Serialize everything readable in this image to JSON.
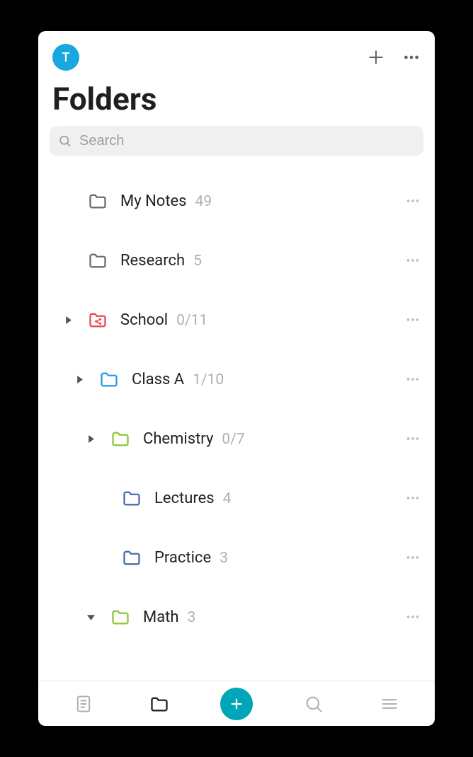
{
  "header": {
    "avatar_letter": "T"
  },
  "page_title": "Folders",
  "search": {
    "placeholder": "Search",
    "value": ""
  },
  "folders": [
    {
      "name": "My Notes",
      "count": "49",
      "indent": 0,
      "chevron": null,
      "icon_color": "#6b6d72",
      "icon_type": "folder"
    },
    {
      "name": "Research",
      "count": "5",
      "indent": 0,
      "chevron": null,
      "icon_color": "#6b6d72",
      "icon_type": "folder"
    },
    {
      "name": "School",
      "count": "0/11",
      "indent": 0,
      "chevron": "right",
      "icon_color": "#e94b57",
      "icon_type": "shared"
    },
    {
      "name": "Class A",
      "count": "1/10",
      "indent": 1,
      "chevron": "right",
      "icon_color": "#2b9be8",
      "icon_type": "folder"
    },
    {
      "name": "Chemistry",
      "count": "0/7",
      "indent": 2,
      "chevron": "right",
      "icon_color": "#8fc63f",
      "icon_type": "folder"
    },
    {
      "name": "Lectures",
      "count": "4",
      "indent": 3,
      "chevron": null,
      "icon_color": "#4a6db0",
      "icon_type": "folder"
    },
    {
      "name": "Practice",
      "count": "3",
      "indent": 3,
      "chevron": null,
      "icon_color": "#4a6db0",
      "icon_type": "folder"
    },
    {
      "name": "Math",
      "count": "3",
      "indent": 2,
      "chevron": "down",
      "icon_color": "#8fc63f",
      "icon_type": "folder"
    }
  ],
  "colors": {
    "accent": "#00a6b7",
    "avatar": "#19a7e0"
  }
}
